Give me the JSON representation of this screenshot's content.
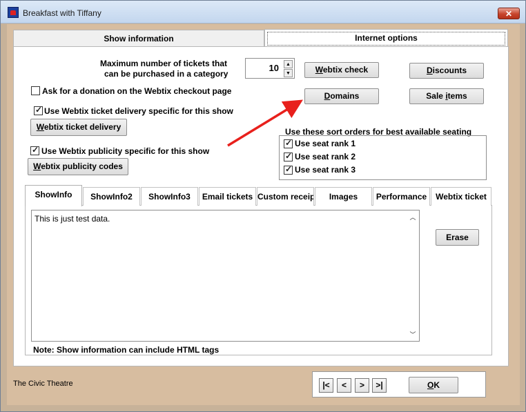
{
  "window": {
    "title": "Breakfast with Tiffany",
    "close_label": "✕"
  },
  "top_tabs": [
    {
      "label": "Show information",
      "active": false
    },
    {
      "label": "Internet options",
      "active": true
    }
  ],
  "max_tickets": {
    "label_line1": "Maximum number of tickets that",
    "label_line2": "can be purchased in a category",
    "value": "10"
  },
  "buttons": {
    "webtix_check": {
      "pre": "",
      "accel": "W",
      "post": "ebtix check"
    },
    "discounts": {
      "pre": "",
      "accel": "D",
      "post": "iscounts"
    },
    "domains": {
      "pre": "",
      "accel": "D",
      "post": "omains"
    },
    "sale_items": {
      "pre": "Sale ",
      "accel": "i",
      "post": "tems"
    },
    "webtix_ticket_delivery": {
      "pre": "",
      "accel": "W",
      "post": "ebtix ticket delivery"
    },
    "webtix_publicity_codes": {
      "pre": "",
      "accel": "W",
      "post": "ebtix publicity codes"
    },
    "erase": "Erase",
    "ok": {
      "pre": "",
      "accel": "O",
      "post": "K"
    }
  },
  "checkboxes": {
    "donation": {
      "label": "Ask for a donation on the Webtix checkout page",
      "checked": false
    },
    "ticket_delivery": {
      "label": "Use Webtix ticket delivery specific for this show",
      "checked": true
    },
    "publicity": {
      "label": "Use Webtix publicity specific for this show",
      "checked": true
    }
  },
  "seating": {
    "title": "Use these sort orders for best available seating",
    "ranks": [
      {
        "label": "Use seat rank 1",
        "checked": true
      },
      {
        "label": "Use seat rank 2",
        "checked": true
      },
      {
        "label": "Use seat rank 3",
        "checked": true
      }
    ]
  },
  "inner_tabs": [
    {
      "label": "ShowInfo",
      "active": true
    },
    {
      "label": "ShowInfo2",
      "active": false
    },
    {
      "label": "ShowInfo3",
      "active": false
    },
    {
      "label": "Email tickets",
      "active": false
    },
    {
      "label": "Custom receipt",
      "active": false
    },
    {
      "label": "Images",
      "active": false
    },
    {
      "label": "Performance",
      "active": false
    },
    {
      "label": "Webtix ticket",
      "active": false
    }
  ],
  "memo": {
    "text": "This is just test data."
  },
  "note": "Note: Show information can include HTML tags",
  "footer": {
    "venue": "The Civic Theatre"
  },
  "nav": {
    "first": "|<",
    "prev": "<",
    "next": ">",
    "last": ">|"
  },
  "colors": {
    "annotation_arrow": "#e8201c",
    "window_background": "#d7bda0"
  },
  "icons": {
    "window_icon": "app-icon",
    "close": "close-icon",
    "scroll_up": "scroll-up-icon",
    "scroll_down": "scroll-down-icon"
  }
}
